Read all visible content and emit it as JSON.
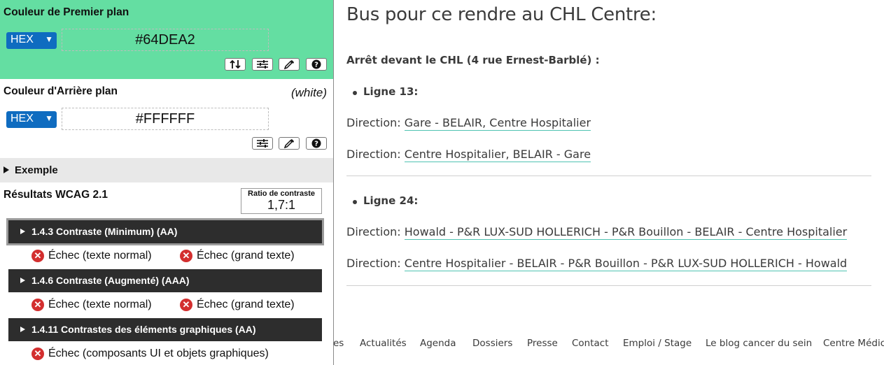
{
  "panel": {
    "foreground": {
      "title": "Couleur de Premier plan",
      "format": "HEX",
      "value": "#64DEA2",
      "bg_color": "#64DEA2"
    },
    "background": {
      "title": "Couleur d'Arrière plan",
      "name": "(white)",
      "format": "HEX",
      "value": "#FFFFFF"
    },
    "example_label": "Exemple",
    "results_title": "Résultats WCAG 2.1",
    "ratio": {
      "label": "Ratio de contraste",
      "value": "1,7:1"
    },
    "criteria": [
      {
        "label": "1.4.3 Contraste (Minimum) (AA)",
        "results": [
          "Échec (texte normal)",
          "Échec (grand texte)"
        ]
      },
      {
        "label": "1.4.6 Contraste (Augmenté) (AAA)",
        "results": [
          "Échec (texte normal)",
          "Échec (grand texte)"
        ]
      },
      {
        "label": "1.4.11 Contrastes des éléments graphiques (AA)",
        "results": [
          "Échec (composants UI et objets graphiques)"
        ]
      }
    ],
    "icons": [
      "swap-icon",
      "sliders-icon",
      "eyedropper-icon",
      "help-icon",
      "fail-icon"
    ],
    "fail_color": "#D32F2F"
  },
  "page": {
    "title": "Bus pour ce rendre au CHL Centre:",
    "stop": "Arrêt devant le CHL (4 rue Ernest-Barblé) :",
    "lines": [
      {
        "name": "Ligne 13:",
        "directions": [
          {
            "label": "Direction:",
            "link": "Gare - BELAIR, Centre Hospitalier"
          },
          {
            "label": "Direction:",
            "link": "Centre Hospitalier, BELAIR - Gare"
          }
        ]
      },
      {
        "name": "Ligne 24:",
        "directions": [
          {
            "label": "Direction:",
            "link": "Howald - P&R LUX-SUD HOLLERICH - P&R Bouillon - BELAIR - Centre Hospitalier"
          },
          {
            "label": "Direction:",
            "link": "Centre Hospitalier - BELAIR - P&R Bouillon - P&R LUX-SUD HOLLERICH - Howald"
          }
        ]
      }
    ],
    "footer": [
      "es",
      "Actualités",
      "Agenda",
      "Dossiers",
      "Presse",
      "Contact",
      "Emploi / Stage",
      "Le blog cancer du sein",
      "Centre Médic"
    ],
    "link_underline_color": "#4FC3B2"
  }
}
